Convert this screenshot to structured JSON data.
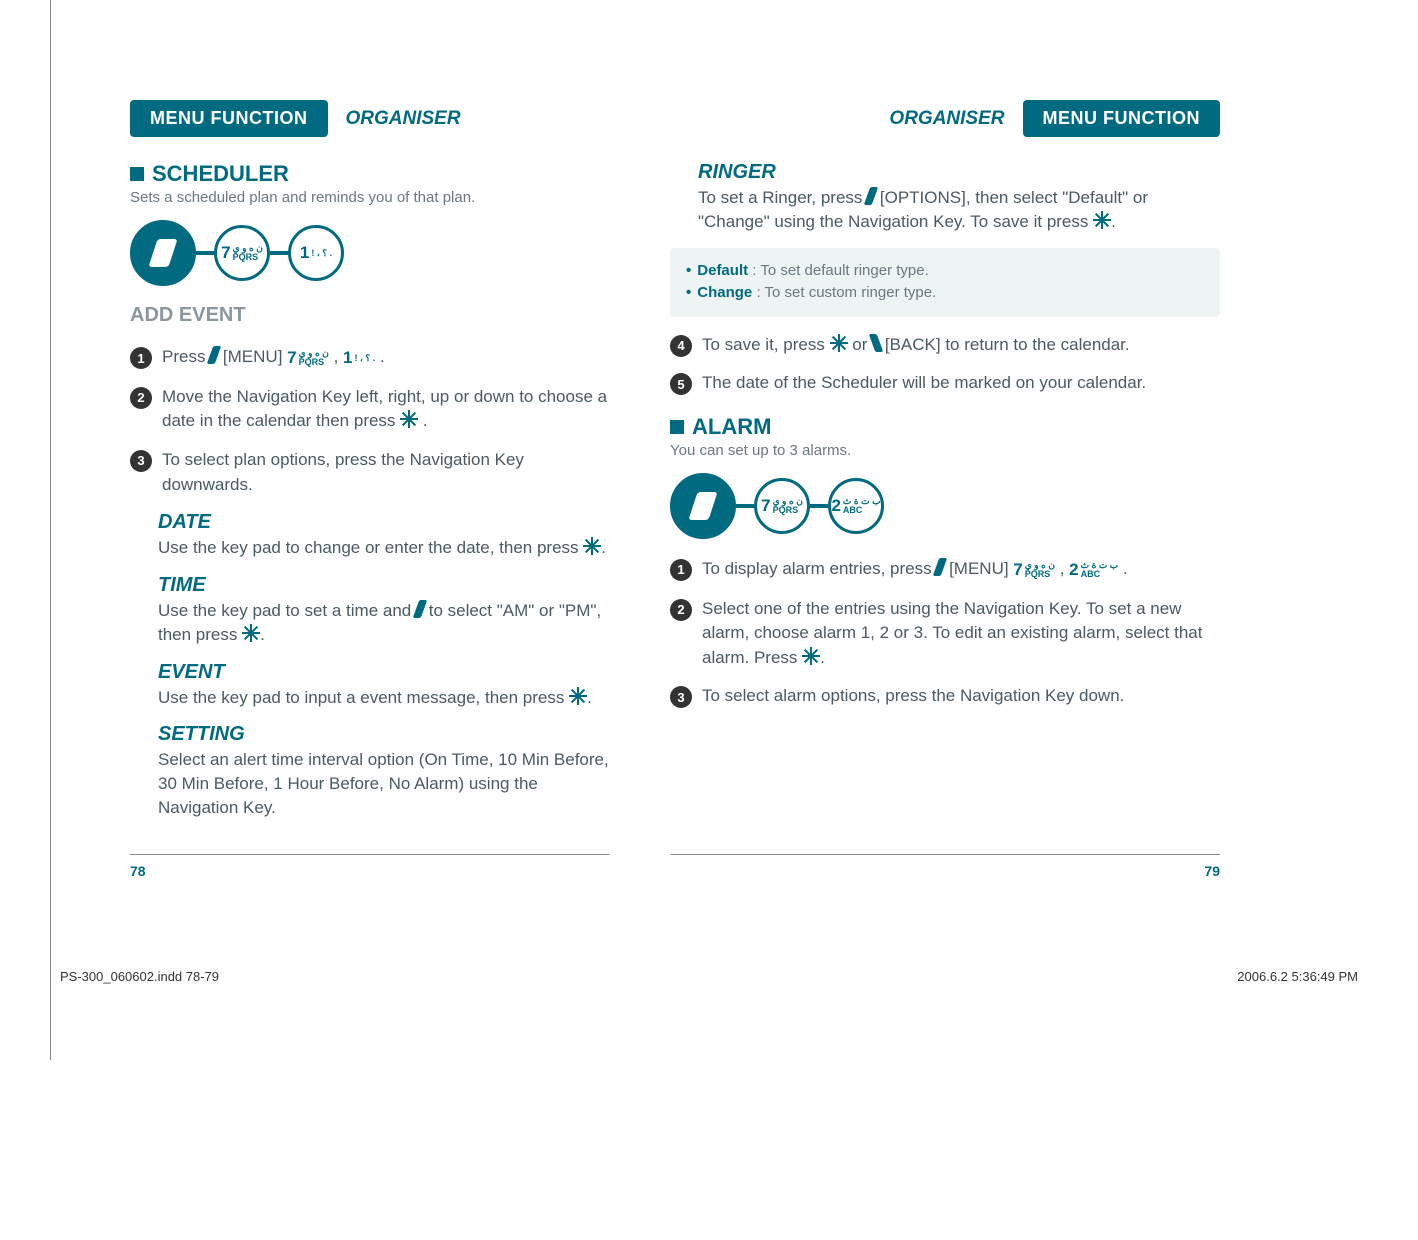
{
  "header": {
    "menu_function": "MENU FUNCTION",
    "organiser": "ORGANISER"
  },
  "left": {
    "scheduler_title": "SCHEDULER",
    "scheduler_sub": "Sets a scheduled plan and reminds you of that plan.",
    "add_event": "ADD EVENT",
    "steps": {
      "s1_a": "Press ",
      "s1_b": "[MENU]  ",
      "s1_k7": "7",
      "s1_k7_sub1": "ن ه و ي",
      "s1_k7_sub2": "PQRS",
      "s1_comma": ", ",
      "s1_k1": "1",
      "s1_k1_sub": "! ، ؟ .",
      "s1_dot": ".",
      "s2": "Move the Navigation Key left, right, up or down to choose a date in the calendar then press ",
      "s2_dot": ".",
      "s3": "To select plan options, press the Navigation Key downwards."
    },
    "date_h": "DATE",
    "date_p": "Use the key pad to change or enter the date, then press ",
    "time_h": "TIME",
    "time_p1": "Use the key pad to set a time and ",
    "time_p2": " to select \"AM\" or \"PM\", then press ",
    "event_h": "EVENT",
    "event_p": "Use the key pad to input a event message, then press ",
    "setting_h": "SETTING",
    "setting_p": "Select an alert time interval option (On Time, 10 Min Before, 30 Min Before, 1 Hour Before, No Alarm) using the Navigation Key.",
    "page_num": "78"
  },
  "right": {
    "ringer_h": "RINGER",
    "ringer_p1": "To set a Ringer, press ",
    "ringer_p2": " [OPTIONS], then select \"Default\" or \"Change\" using the Navigation Key. To save it press ",
    "note_default_k": "Default",
    "note_default_v": " : To set default ringer type.",
    "note_change_k": "Change",
    "note_change_v": " : To set custom ringer type.",
    "s4a": "To save it, press ",
    "s4b": " or  ",
    "s4c": " [BACK] to return to the calendar.",
    "s5": "The date of the Scheduler will be marked on your calendar.",
    "alarm_title": "ALARM",
    "alarm_sub": "You can set up to 3 alarms.",
    "a1a": "To display alarm entries, press ",
    "a1b": " [MENU]  ",
    "a1_k7": "7",
    "a1_k7_sub1": "ن ه و ي",
    "a1_k7_sub2": "PQRS",
    "a1_comma": ",  ",
    "a1_k2": "2",
    "a1_k2_sub1": "ب ت ة ث",
    "a1_k2_sub2": "ABC",
    "a1_dot": ".",
    "a2": "Select one of the entries using the Navigation Key. To set a new alarm, choose alarm 1, 2 or 3. To edit an existing alarm, select that alarm. Press ",
    "a3": "To select alarm options, press the Navigation Key down.",
    "page_num": "79"
  },
  "footer": {
    "indd": "PS-300_060602.indd   78-79",
    "stamp": "2006.6.2   5:36:49 PM"
  },
  "keychain": {
    "k7": "7",
    "k7_sub1": "ن ه و ي",
    "k7_sub2": "PQRS",
    "k1": "1",
    "k1_sub": "! ، ؟ .",
    "k2": "2",
    "k2_sub1": "ب ت ة ث",
    "k2_sub2": "ABC"
  }
}
